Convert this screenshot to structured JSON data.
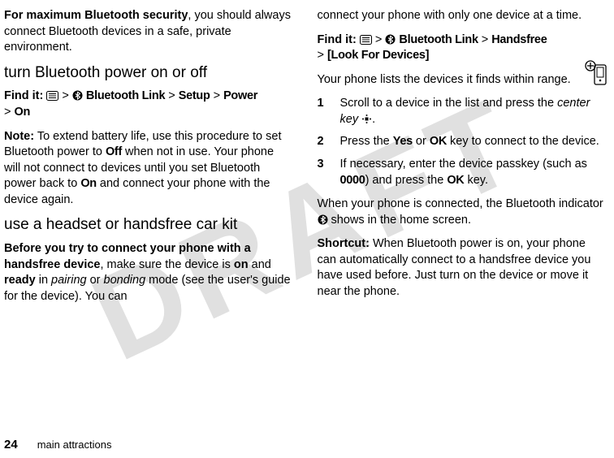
{
  "watermark": "DRAFT",
  "left": {
    "intro_bold": "For maximum Bluetooth security",
    "intro_rest": ", you should always connect Bluetooth devices in a safe, private environment.",
    "h1": "turn Bluetooth power on or off",
    "find_it": "Find it:",
    "path1_a": "Bluetooth Link",
    "path1_b": "Setup",
    "path1_c": "Power",
    "path1_d": "On",
    "gt": ">",
    "note_label": "Note:",
    "note_text_a": " To extend battery life, use this procedure to set Bluetooth power to ",
    "note_off": "Off",
    "note_text_b": " when not in use. Your phone will not connect to devices until you set Bluetooth power back to ",
    "note_on": "On",
    "note_text_c": " and connect your phone with the device again.",
    "h2": "use a headset or handsfree car kit",
    "before_bold": "Before you try to connect your phone with a handsfree device",
    "before_a": ", make sure the device is ",
    "before_on": "on",
    "before_b": " and ",
    "before_ready": "ready",
    "before_c": " in ",
    "before_pairing": "pairing",
    "before_d": "  or ",
    "before_bonding": "bonding",
    "before_e": "  mode (see the user's guide for the device). You can "
  },
  "right": {
    "cont": "connect your phone with only one device at a time.",
    "find_it": "Find it:",
    "gt": ">",
    "path2_a": "Bluetooth Link",
    "path2_b": "Handsfree",
    "path2_c": "[Look For Devices]",
    "list_intro": "Your phone lists the devices it finds within range.",
    "step1_num": "1",
    "step1_a": "Scroll to a device in the list and press the ",
    "step1_key": "center key",
    "step1_b": ".",
    "step2_num": "2",
    "step2_a": "Press the ",
    "step2_yes": "Yes",
    "step2_or": " or ",
    "step2_ok": "OK",
    "step2_b": " key to connect to the device.",
    "step3_num": "3",
    "step3_a": "If necessary, enter the device passkey (such as ",
    "step3_code": "0000",
    "step3_b": ") and press the ",
    "step3_ok": "OK",
    "step3_c": " key.",
    "connected_a": "When your phone is connected, the Bluetooth indicator ",
    "connected_b": " shows in the home screen.",
    "shortcut_label": "Shortcut:",
    "shortcut_text": " When Bluetooth power is on, your phone can automatically connect to a handsfree device you have used before. Just turn on the device or move it near the phone."
  },
  "footer": {
    "page": "24",
    "section": "main attractions"
  }
}
